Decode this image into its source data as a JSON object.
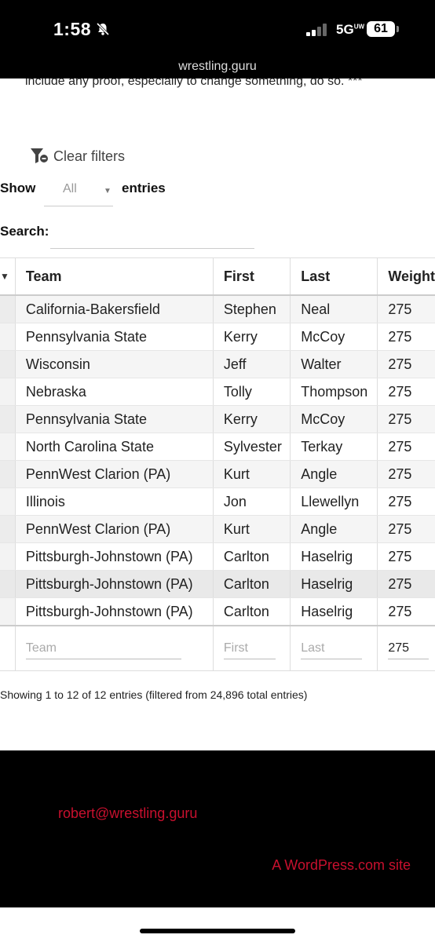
{
  "status": {
    "time": "1:58",
    "network": "5G",
    "network_sub": "UW",
    "battery": "61",
    "url": "wrestling.guru"
  },
  "intro_text": "include any proof, especially to change something, do so. ***",
  "filters": {
    "clear_label": "Clear filters"
  },
  "length": {
    "show_label": "Show",
    "value": "All",
    "entries_label": "entries"
  },
  "search": {
    "label": "Search:"
  },
  "table": {
    "headers": [
      "Team",
      "First",
      "Last",
      "Weight"
    ],
    "rows": [
      [
        "California-Bakersfield",
        "Stephen",
        "Neal",
        "275"
      ],
      [
        "Pennsylvania State",
        "Kerry",
        "McCoy",
        "275"
      ],
      [
        "Wisconsin",
        "Jeff",
        "Walter",
        "275"
      ],
      [
        "Nebraska",
        "Tolly",
        "Thompson",
        "275"
      ],
      [
        "Pennsylvania State",
        "Kerry",
        "McCoy",
        "275"
      ],
      [
        "North Carolina State",
        "Sylvester",
        "Terkay",
        "275"
      ],
      [
        "PennWest Clarion (PA)",
        "Kurt",
        "Angle",
        "275"
      ],
      [
        "Illinois",
        "Jon",
        "Llewellyn",
        "275"
      ],
      [
        "PennWest Clarion (PA)",
        "Kurt",
        "Angle",
        "275"
      ],
      [
        "Pittsburgh-Johnstown (PA)",
        "Carlton",
        "Haselrig",
        "275"
      ],
      [
        "Pittsburgh-Johnstown (PA)",
        "Carlton",
        "Haselrig",
        "275"
      ],
      [
        "Pittsburgh-Johnstown (PA)",
        "Carlton",
        "Haselrig",
        "275"
      ]
    ],
    "footer_filters": {
      "team_placeholder": "Team",
      "first_placeholder": "First",
      "last_placeholder": "Last",
      "weight_value": "275"
    }
  },
  "info": "Showing 1 to 12 of 12 entries (filtered from 24,896 total entries)",
  "footer": {
    "email": "robert@wrestling.guru",
    "wordpress": "A WordPress.com site",
    "accent_color": "#c8102e"
  }
}
